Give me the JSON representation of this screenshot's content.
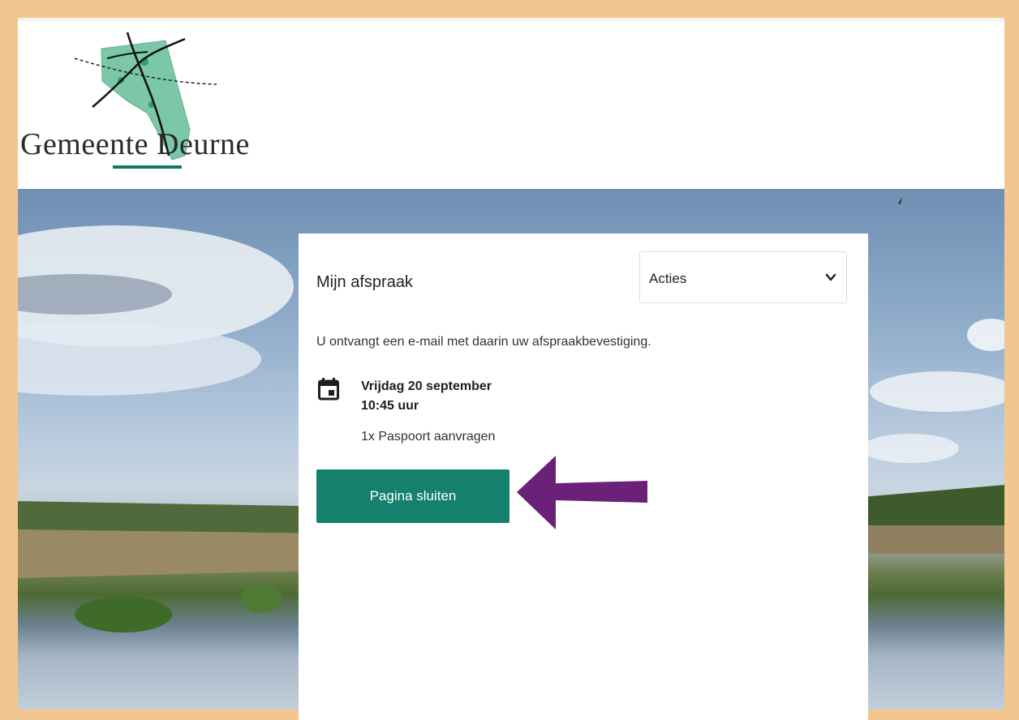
{
  "brand": {
    "logo_text": "Gemeente Deurne",
    "accent_color": "#14806d",
    "frame_color": "#f3c690"
  },
  "appointment": {
    "title": "Mijn afspraak",
    "actions_select": {
      "selected": "Acties",
      "icon": "chevron-down-icon"
    },
    "confirmation_text": "U ontvangt een e-mail met daarin uw afspraakbevestiging.",
    "date_icon": "calendar-icon",
    "date": "Vrijdag 20 september",
    "time": "10:45 uur",
    "service": "1x Paspoort aanvragen",
    "close_button_label": "Pagina sluiten"
  },
  "annotation": {
    "type": "arrow-left",
    "color": "#6b2178"
  }
}
